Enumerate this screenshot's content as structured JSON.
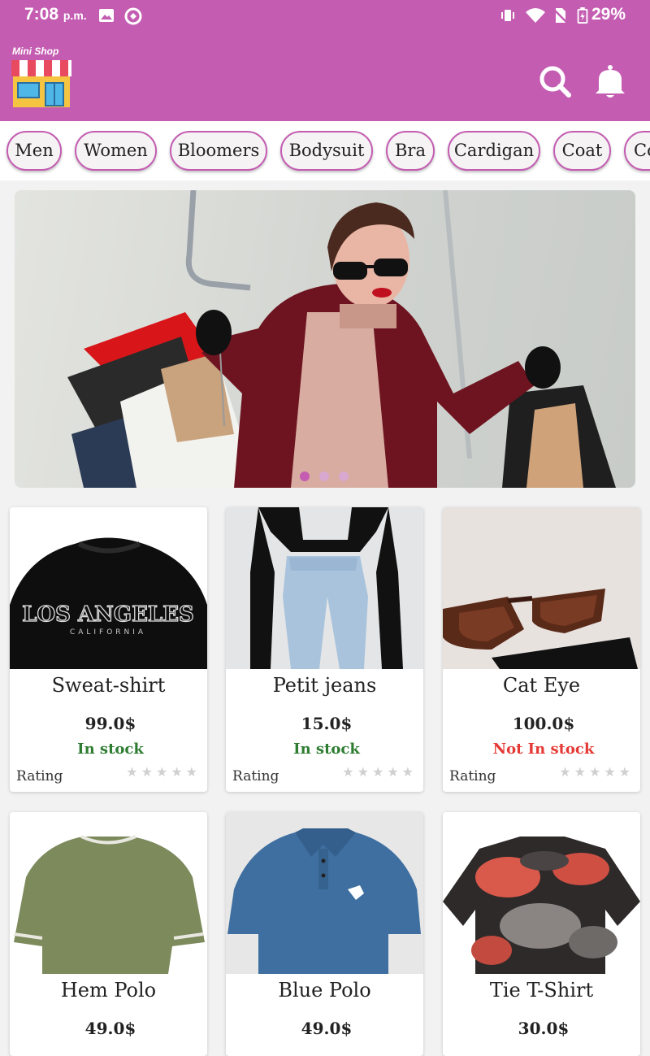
{
  "status_bar": {
    "time": "7:08",
    "time_suffix": "p.m.",
    "battery": "29%"
  },
  "app_bar": {
    "logo_text": "Mini Shop"
  },
  "categories": [
    "Men",
    "Women",
    "Bloomers",
    "Bodysuit",
    "Bra",
    "Cardigan",
    "Coat",
    "Co"
  ],
  "banner": {
    "slide_count": 3,
    "active_slide": 1
  },
  "products": [
    {
      "name": "Sweat-shirt",
      "price": "99.0$",
      "stock": "In stock",
      "stock_color": "#2e7d32",
      "rating_label": "Rating",
      "stars": "★★★★★"
    },
    {
      "name": "Petit jeans",
      "price": "15.0$",
      "stock": "In stock",
      "stock_color": "#2e7d32",
      "rating_label": "Rating",
      "stars": "★★★★★"
    },
    {
      "name": "Cat Eye",
      "price": "100.0$",
      "stock": "Not In stock",
      "stock_color": "#e53935",
      "rating_label": "Rating",
      "stars": "★★★★★"
    },
    {
      "name": "Hem Polo",
      "price": "49.0$"
    },
    {
      "name": "Blue Polo",
      "price": "49.0$"
    },
    {
      "name": "Tie T-Shirt",
      "price": "30.0$"
    }
  ],
  "colors": {
    "accent": "#c45db2",
    "in_stock": "#2e7d32",
    "out_of_stock": "#e53935"
  }
}
